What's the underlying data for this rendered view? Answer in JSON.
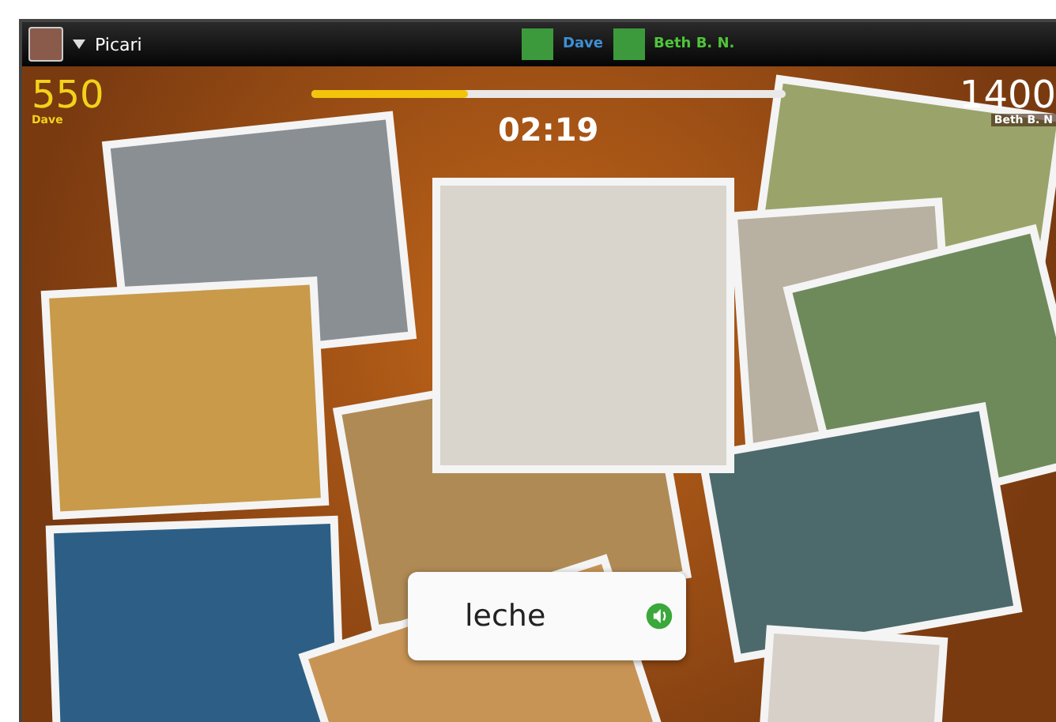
{
  "app": {
    "title": "Picari"
  },
  "players": [
    {
      "name": "Dave",
      "color": "#3f8fd6"
    },
    {
      "name": "Beth B. N.",
      "color": "#4fc43a"
    }
  ],
  "scores": [
    {
      "score": "550",
      "name": "Dave"
    },
    {
      "score": "1400",
      "name": "Beth B. N"
    }
  ],
  "progress": {
    "level": 0.33
  },
  "timer": "02:19",
  "word_card": {
    "word": "leche"
  }
}
